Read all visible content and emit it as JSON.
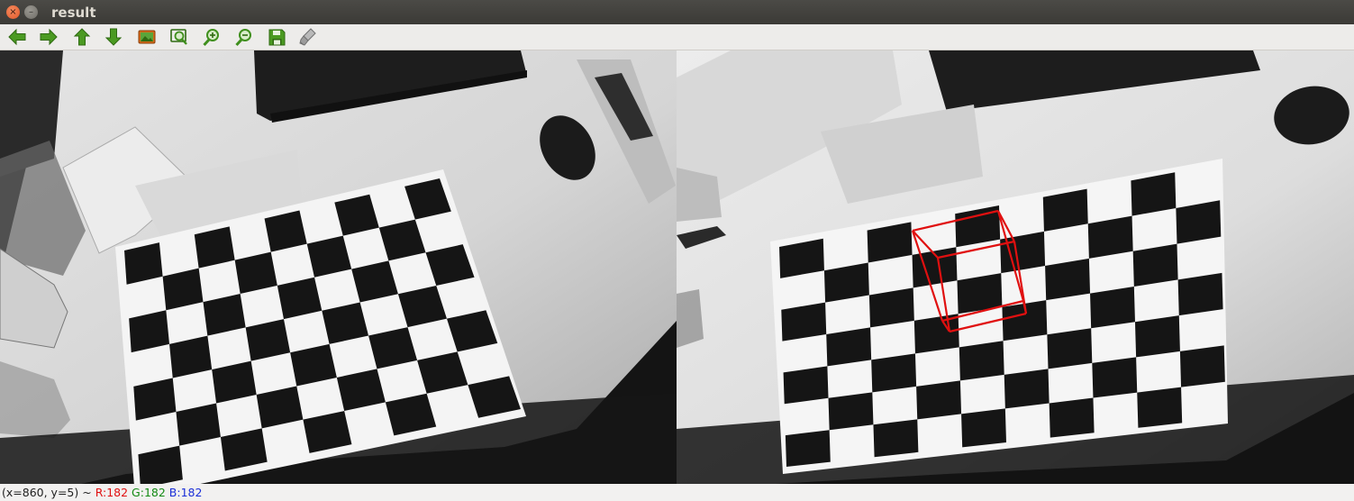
{
  "window": {
    "title": "result"
  },
  "toolbar": {
    "buttons": [
      {
        "icon": "arrow-left-icon",
        "color": "#3f8f1d"
      },
      {
        "icon": "arrow-right-icon",
        "color": "#3f8f1d"
      },
      {
        "icon": "arrow-up-icon",
        "color": "#3f8f1d"
      },
      {
        "icon": "arrow-down-icon",
        "color": "#3f8f1d"
      },
      {
        "icon": "image-icon",
        "color": "#d26b19"
      },
      {
        "icon": "zoom-fit-icon",
        "color": "#3f8f1d"
      },
      {
        "icon": "zoom-in-icon",
        "color": "#3f8f1d"
      },
      {
        "icon": "zoom-out-icon",
        "color": "#3f8f1d"
      },
      {
        "icon": "save-icon",
        "color": "#3f8f1d"
      },
      {
        "icon": "properties-icon",
        "color": "#8a8a8a"
      }
    ]
  },
  "status": {
    "coords": "(x=860, y=5) ~",
    "r": "R:182",
    "g": "G:182",
    "b": "B:182"
  },
  "colors": {
    "cube": "#e01010",
    "status_r": "#e01010",
    "status_g": "#138a13",
    "status_b": "#1b2fd8"
  }
}
